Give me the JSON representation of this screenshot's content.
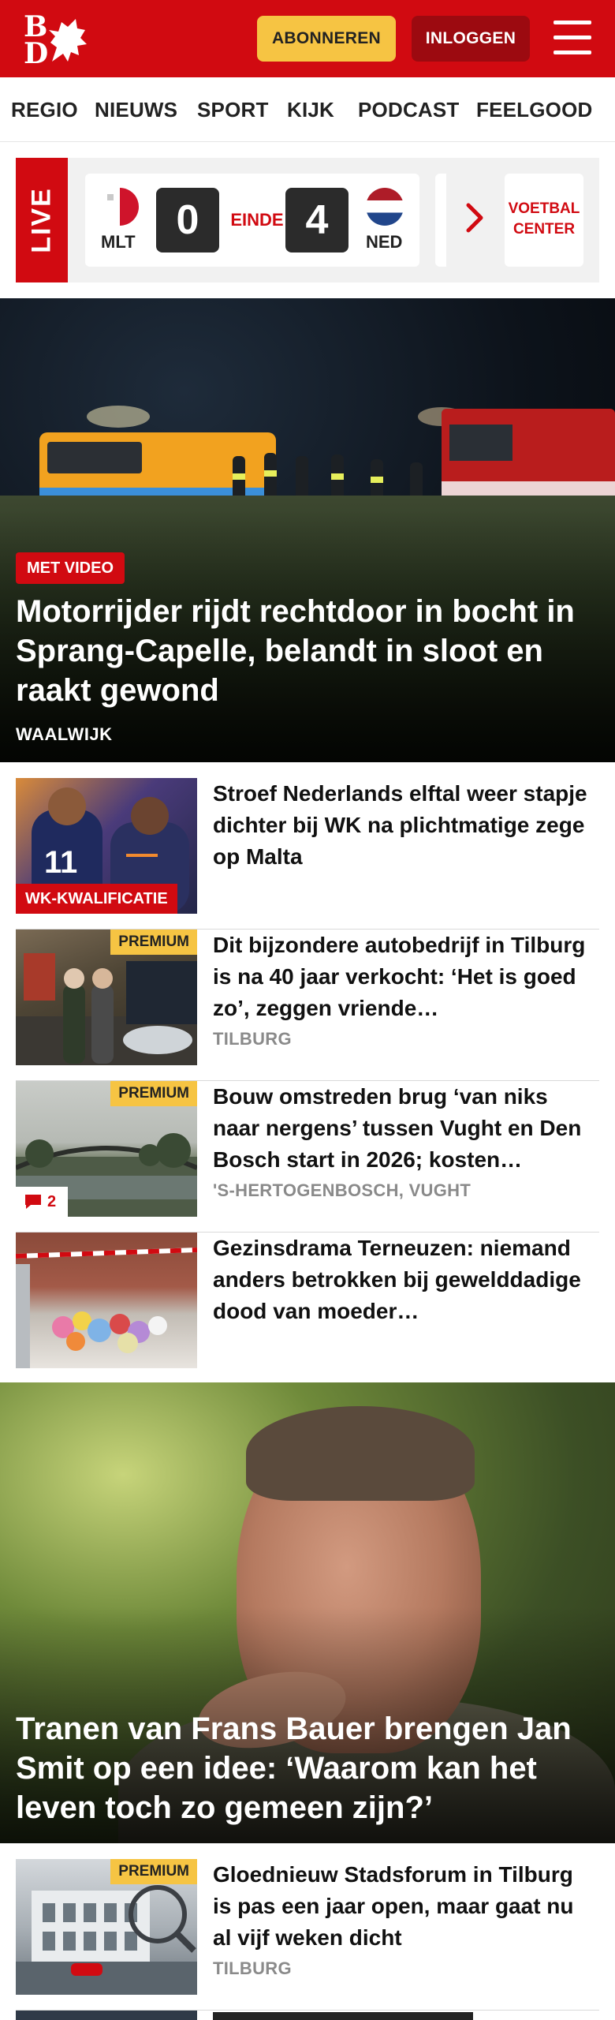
{
  "header": {
    "logo_letters": [
      "B",
      "D"
    ],
    "subscribe_label": "ABONNEREN",
    "login_label": "INLOGGEN",
    "brand_color": "#d10a11"
  },
  "nav": {
    "items": [
      "REGIO",
      "NIEUWS",
      "SPORT",
      "KIJK",
      "PODCAST",
      "FEELGOOD"
    ]
  },
  "live": {
    "label": "LIVE",
    "home_code": "MLT",
    "home_score": "0",
    "status": "EINDE",
    "away_score": "4",
    "away_code": "NED",
    "center_label": "VOETBAL CENTER"
  },
  "hero": {
    "badge": "MET VIDEO",
    "title": "Motorrijder rijdt rechtdoor in bocht in Sprang-Capelle, belandt in sloot en raakt gewond",
    "location": "WAALWIJK"
  },
  "articles": [
    {
      "title": "Stroef Nederlands elftal weer stapje dichter bij WK na plichtmatige zege op Malta",
      "location": "",
      "tag": "WK-KWALIFICATIE"
    },
    {
      "title": "Dit bijzondere autobedrijf in Tilburg is na 40 jaar verkocht: ‘Het is goed zo’, zeggen vriende…",
      "location": "TILBURG",
      "premium": "PREMIUM"
    },
    {
      "title": "Bouw omstreden brug ‘van niks naar nergens’ tussen Vught en Den Bosch start in 2026; kosten…",
      "location": "'S-HERTOGENBOSCH, VUGHT",
      "premium": "PREMIUM",
      "comments": "2"
    },
    {
      "title": "Gezinsdrama Terneuzen: niemand anders betrokken bij gewelddadige dood van moeder…",
      "location": ""
    },
    {
      "title": "Gloednieuw Stadsforum in Tilburg is pas een jaar open, maar gaat nu al vijf weken dicht",
      "location": "TILBURG",
      "premium": "PREMIUM"
    }
  ],
  "feature": {
    "title": "Tranen van Frans Bauer brengen Jan Smit op een idee: ‘Waarom kan het leven toch zo gemeen zijn?’"
  }
}
